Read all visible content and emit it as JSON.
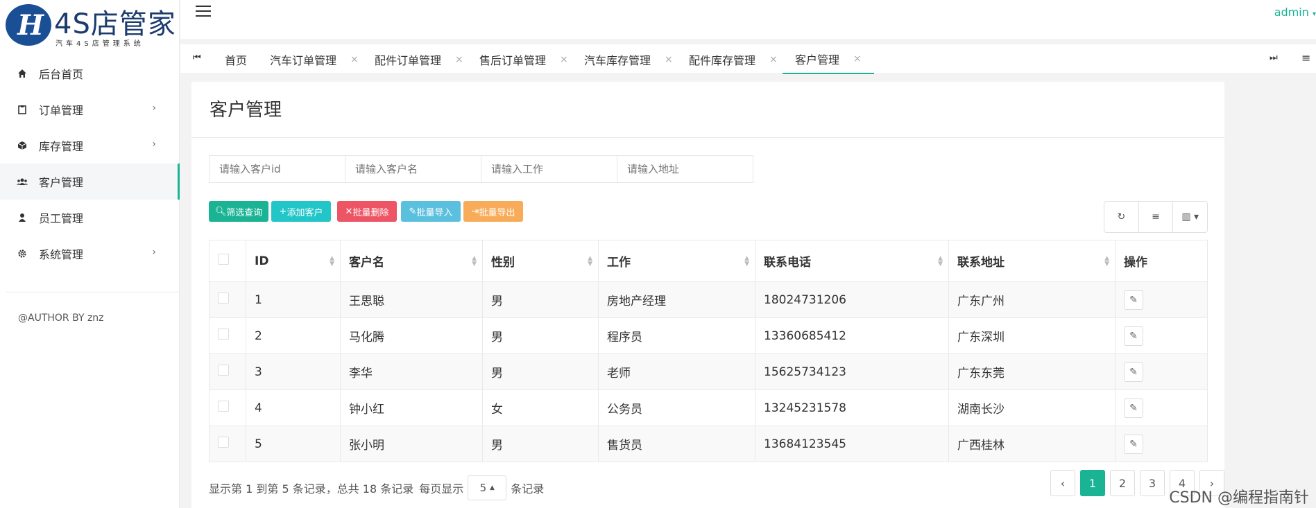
{
  "logo": {
    "mark": "H",
    "title": "4S店管家",
    "subtitle": "汽车4S店管理系统"
  },
  "sidebar": {
    "items": [
      {
        "label": "后台首页",
        "icon": "home-icon",
        "has_arrow": false,
        "active": false
      },
      {
        "label": "订单管理",
        "icon": "clipboard-icon",
        "has_arrow": true,
        "active": false
      },
      {
        "label": "库存管理",
        "icon": "cube-icon",
        "has_arrow": true,
        "active": false
      },
      {
        "label": "客户管理",
        "icon": "users-icon",
        "has_arrow": false,
        "active": true
      },
      {
        "label": "员工管理",
        "icon": "user-icon",
        "has_arrow": false,
        "active": false
      },
      {
        "label": "系统管理",
        "icon": "gear-icon",
        "has_arrow": true,
        "active": false
      }
    ],
    "author": "@AUTHOR BY znz"
  },
  "topbar": {
    "user": "admin"
  },
  "tabs": [
    {
      "label": "首页",
      "closable": false
    },
    {
      "label": "汽车订单管理",
      "closable": true
    },
    {
      "label": "配件订单管理",
      "closable": true
    },
    {
      "label": "售后订单管理",
      "closable": true
    },
    {
      "label": "汽车库存管理",
      "closable": true
    },
    {
      "label": "配件库存管理",
      "closable": true
    },
    {
      "label": "客户管理",
      "closable": true,
      "active": true
    }
  ],
  "panel": {
    "title": "客户管理"
  },
  "search": {
    "id_placeholder": "请输入客户id",
    "name_placeholder": "请输入客户名",
    "job_placeholder": "请输入工作",
    "address_placeholder": "请输入地址"
  },
  "buttons": {
    "query": "筛选查询",
    "add": "添加客户",
    "batch_delete": "批量删除",
    "batch_import": "批量导入",
    "batch_export": "批量导出"
  },
  "colors": {
    "accent": "#1ab394",
    "info": "#23c6c8",
    "danger": "#ed5565",
    "import": "#5bc0de",
    "warning": "#f8ac59"
  },
  "table": {
    "headers": [
      "ID",
      "客户名",
      "性别",
      "工作",
      "联系电话",
      "联系地址",
      "操作"
    ],
    "rows": [
      [
        "1",
        "王思聪",
        "男",
        "房地产经理",
        "18024731206",
        "广东广州"
      ],
      [
        "2",
        "马化腾",
        "男",
        "程序员",
        "13360685412",
        "广东深圳"
      ],
      [
        "3",
        "李华",
        "男",
        "老师",
        "15625734123",
        "广东东莞"
      ],
      [
        "4",
        "钟小红",
        "女",
        "公务员",
        "13245231578",
        "湖南长沙"
      ],
      [
        "5",
        "张小明",
        "男",
        "售货员",
        "13684123545",
        "广西桂林"
      ]
    ]
  },
  "footer": {
    "summary": "显示第 1 到第 5 条记录，总共 18 条记录",
    "per_page_prefix": "每页显示",
    "per_page_value": "5",
    "per_page_suffix": "条记录"
  },
  "pagination": {
    "prev": "‹",
    "pages": [
      "1",
      "2",
      "3",
      "4"
    ],
    "next": "›",
    "current": "1"
  },
  "watermark": "CSDN @编程指南针"
}
